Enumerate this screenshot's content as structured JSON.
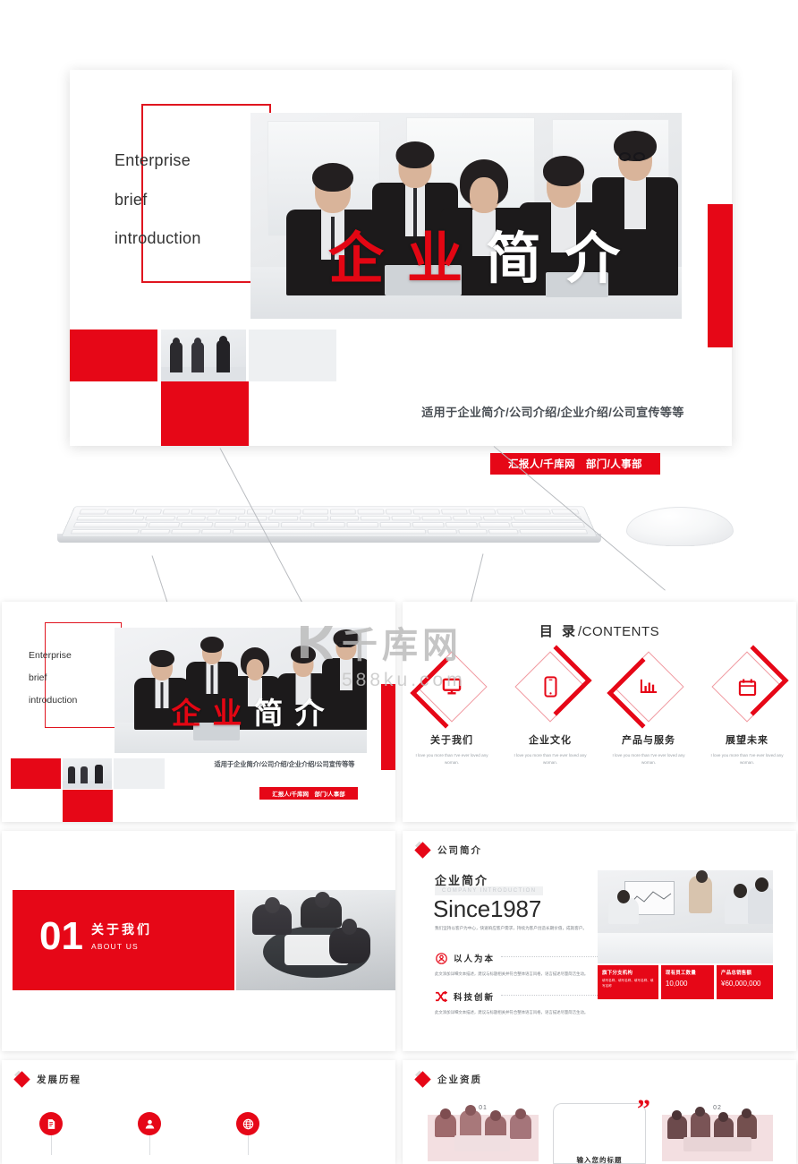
{
  "brand": {
    "red": "#e60717",
    "red_dark": "#e0151f",
    "text": "#2d2d2d"
  },
  "hero": {
    "english_lines": [
      "Enterprise",
      "brief",
      "introduction"
    ],
    "title_chars": [
      "企",
      "业",
      "简",
      "介"
    ],
    "subtitle": "适用于企业简介/公司介绍/企业介绍/公司宣传等等",
    "badge": "汇报人/千库网　部门/人事部"
  },
  "watermark": {
    "cn": "千库网",
    "url": "588ku.com"
  },
  "slides": {
    "contents": {
      "title_cn": "目 录",
      "title_sep": "/",
      "title_en": "CONTENTS",
      "items": [
        {
          "label": "关于我们",
          "desc": "I love you more than I've ever loved any woman.",
          "icon": "monitor-icon",
          "accent": "bottom-left"
        },
        {
          "label": "企业文化",
          "desc": "I love you more than I've ever loved any woman.",
          "icon": "phone-icon",
          "accent": "top-right"
        },
        {
          "label": "产品与服务",
          "desc": "I love you more than I've ever loved any woman.",
          "icon": "bar-chart-icon",
          "accent": "bottom-left"
        },
        {
          "label": "展望未来",
          "desc": "I love you more than I've ever loved any woman.",
          "icon": "calendar-icon",
          "accent": "top-right"
        }
      ]
    },
    "section_divider": {
      "number": "01",
      "title_cn": "关于我们",
      "title_en": "ABOUT US"
    },
    "company_intro": {
      "header": "公司简介",
      "heading_cn": "企业简介",
      "heading_en": "COMPANY INTRODUCTION",
      "since": "Since1987",
      "paragraph": "我们坚持以客户为中心，快速响应客户需求，持续为客户创造长期价值，成就客户。",
      "features": [
        {
          "title": "以人为本",
          "icon": "people-icon",
          "desc": "此文添加详细文本描述，建议与标题相关并符合整体语言风格，语言描述尽量简洁生动。"
        },
        {
          "title": "科技创新",
          "icon": "shuffle-icon",
          "desc": "此文添加详细文本描述，建议与标题相关并符合整体语言风格，语言描述尽量简洁生动。"
        }
      ],
      "stats": [
        {
          "label": "旗下分支机构",
          "sub": "填写名称、填写名称、填写名称、填写名称",
          "value": ""
        },
        {
          "label": "现有员工数量",
          "sub": "",
          "value": "10,000"
        },
        {
          "label": "产品总销售额",
          "sub": "",
          "value": "¥60,000,000"
        }
      ]
    },
    "timeline": {
      "header": "发展历程",
      "nodes": [
        {
          "icon": "document-icon"
        },
        {
          "icon": "user-icon"
        },
        {
          "icon": "globe-icon"
        }
      ]
    },
    "qualification": {
      "header": "企业资质",
      "items": [
        {
          "num": "01"
        },
        {
          "num": "02"
        }
      ],
      "quote_mark": "”",
      "card_caption": "输入您的标题"
    }
  }
}
